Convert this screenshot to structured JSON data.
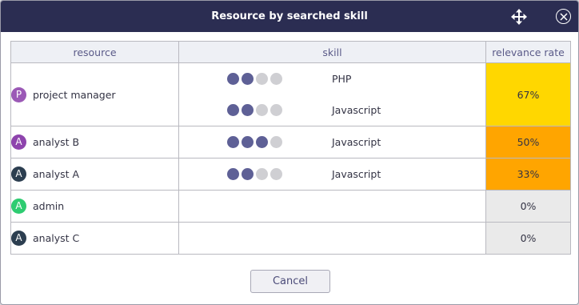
{
  "dialog": {
    "title": "Resource by searched skill",
    "cancel_label": "Cancel"
  },
  "table": {
    "headers": [
      "resource",
      "skill",
      "relevance rate"
    ],
    "rows": [
      {
        "initial": "P",
        "avatar_color": "#9b59b6",
        "name": "project manager",
        "skills": [
          {
            "name": "PHP",
            "level": 2,
            "max": 4
          },
          {
            "name": "Javascript",
            "level": 2,
            "max": 4
          }
        ],
        "rate": "67%",
        "rate_color": "#ffd700"
      },
      {
        "initial": "A",
        "avatar_color": "#8e44ad",
        "name": "analyst B",
        "skills": [
          {
            "name": "Javascript",
            "level": 3,
            "max": 4
          }
        ],
        "rate": "50%",
        "rate_color": "#ffa500"
      },
      {
        "initial": "A",
        "avatar_color": "#2c3e50",
        "name": "analyst A",
        "skills": [
          {
            "name": "Javascript",
            "level": 2,
            "max": 4
          }
        ],
        "rate": "33%",
        "rate_color": "#ffa500"
      },
      {
        "initial": "A",
        "avatar_color": "#2ecc71",
        "name": "admin",
        "skills": [],
        "rate": "0%",
        "rate_color": "#eaeaea"
      },
      {
        "initial": "A",
        "avatar_color": "#2c3e50",
        "name": "analyst C",
        "skills": [],
        "rate": "0%",
        "rate_color": "#eaeaea"
      }
    ]
  },
  "icons": {
    "move": "move-arrows-icon",
    "close": "close-circle-icon"
  }
}
